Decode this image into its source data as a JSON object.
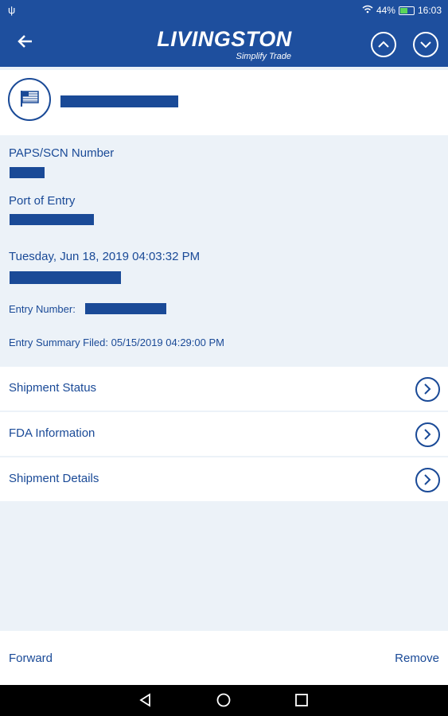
{
  "status_bar": {
    "battery_percent": "44%",
    "time": "16:03"
  },
  "app_bar": {
    "logo_name": "LIVINGSTON",
    "logo_tagline": "Simplify Trade"
  },
  "details": {
    "paps_label": "PAPS/SCN Number",
    "port_label": "Port of Entry",
    "datetime": "Tuesday, Jun 18, 2019 04:03:32 PM",
    "entry_number_label": "Entry Number:",
    "entry_summary": "Entry Summary Filed: 05/15/2019 04:29:00 PM"
  },
  "rows": [
    {
      "label": "Shipment Status"
    },
    {
      "label": "FDA Information"
    },
    {
      "label": "Shipment Details"
    }
  ],
  "footer": {
    "forward_label": "Forward",
    "remove_label": "Remove"
  },
  "colors": {
    "brand_blue": "#1e4f9e",
    "text_blue": "#1a4a97",
    "background": "#ecf2f8"
  },
  "icons": [
    "usb-icon",
    "wifi-icon",
    "battery-icon",
    "back-arrow-icon",
    "up-arrow-icon",
    "down-arrow-icon",
    "flag-icon",
    "chevron-right-icon",
    "back-triangle-icon",
    "home-circle-icon",
    "recents-square-icon"
  ]
}
